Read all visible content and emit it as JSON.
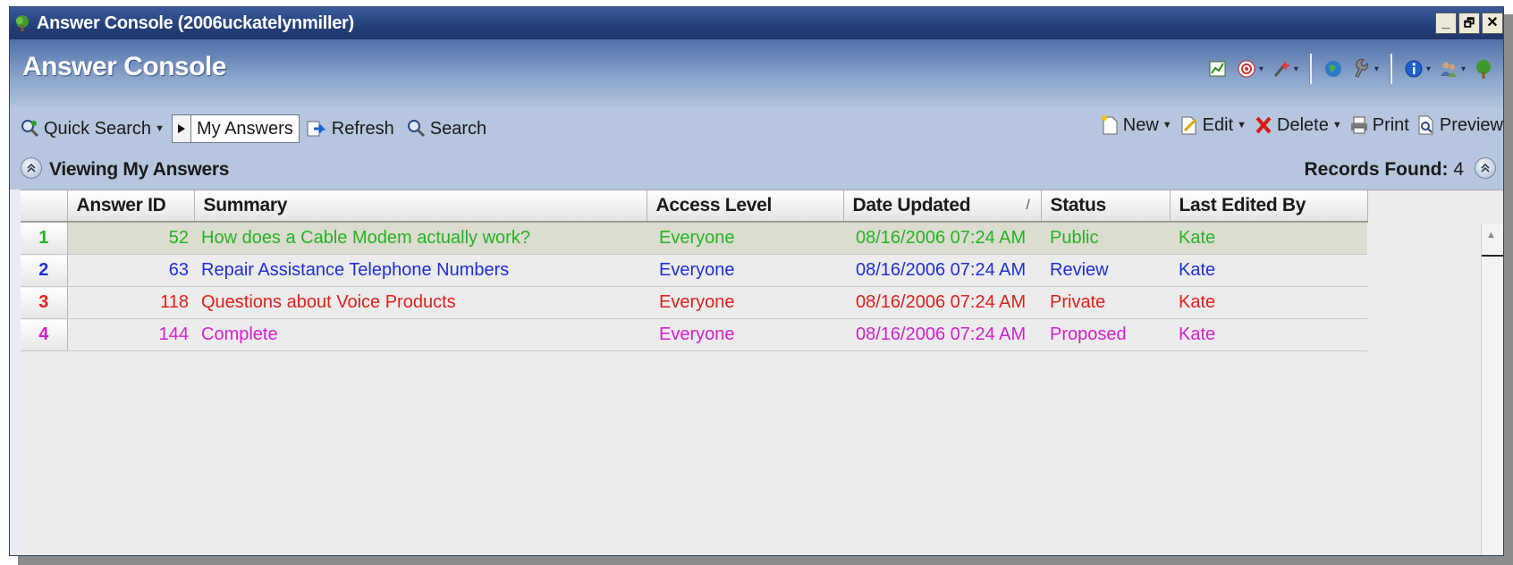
{
  "window": {
    "title": "Answer Console (2006uckatelynmiller)",
    "controls": [
      "_",
      "🗗",
      "✕"
    ]
  },
  "header": {
    "title": "Answer Console",
    "icons": [
      "reports-icon",
      "target-icon",
      "wand-icon",
      "globe-icon",
      "tools-icon",
      "info-icon",
      "users-icon",
      "tree-icon"
    ]
  },
  "toolbar": {
    "quick_search": "Quick Search",
    "my_answers": "My Answers",
    "refresh": "Refresh",
    "search": "Search",
    "new": "New",
    "edit": "Edit",
    "delete": "Delete",
    "print": "Print",
    "preview": "Preview"
  },
  "subbar": {
    "viewing": "Viewing My Answers",
    "records_label": "Records Found:",
    "records_count": "4"
  },
  "table": {
    "columns": [
      "Answer ID",
      "Summary",
      "Access Level",
      "Date Updated",
      "Status",
      "Last Edited By"
    ],
    "sort_indicator": "/",
    "rows": [
      {
        "num": "1",
        "id": "52",
        "summary": "How does a Cable Modem actually work?",
        "access": "Everyone",
        "date": "08/16/2006 07:24 AM",
        "status": "Public",
        "editor": "Kate",
        "color": "#22b422"
      },
      {
        "num": "2",
        "id": "63",
        "summary": "Repair Assistance Telephone Numbers",
        "access": "Everyone",
        "date": "08/16/2006 07:24 AM",
        "status": "Review",
        "editor": "Kate",
        "color": "#1f2fd6"
      },
      {
        "num": "3",
        "id": "118",
        "summary": "Questions about Voice Products",
        "access": "Everyone",
        "date": "08/16/2006 07:24 AM",
        "status": "Private",
        "editor": "Kate",
        "color": "#e0201c"
      },
      {
        "num": "4",
        "id": "144",
        "summary": "Complete",
        "access": "Everyone",
        "date": "08/16/2006 07:24 AM",
        "status": "Proposed",
        "editor": "Kate",
        "color": "#d31fd0"
      }
    ]
  }
}
